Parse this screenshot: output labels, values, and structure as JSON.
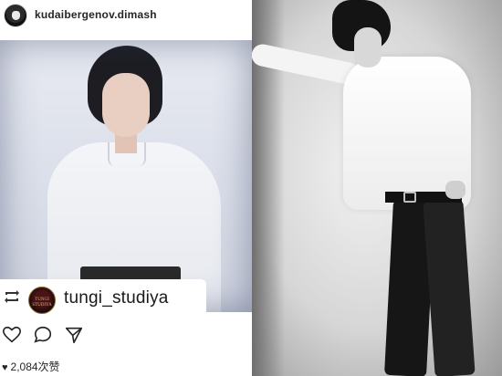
{
  "post": {
    "username": "kudaibergenov.dimash",
    "repost": {
      "username": "tungi_studiya",
      "avatar_text": "TUNGI STUDIYA"
    },
    "actions": {
      "like_icon": "heart-outline-icon",
      "comment_icon": "comment-bubble-icon",
      "share_icon": "paper-plane-icon"
    },
    "likes_text": "2,084次赞"
  },
  "colors": {
    "text": "#262626",
    "background": "#ffffff"
  }
}
